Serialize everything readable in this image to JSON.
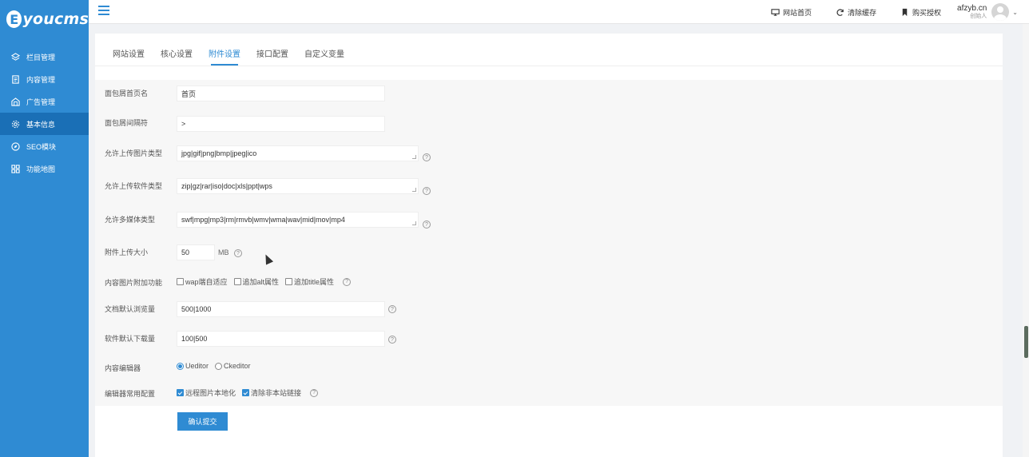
{
  "brand": {
    "badge": "E",
    "name": "youcms"
  },
  "sidebar": {
    "items": [
      {
        "label": "栏目管理",
        "icon": "layers-icon"
      },
      {
        "label": "内容管理",
        "icon": "document-icon"
      },
      {
        "label": "广告管理",
        "icon": "ad-icon"
      },
      {
        "label": "基本信息",
        "icon": "gear-icon"
      },
      {
        "label": "SEO模块",
        "icon": "compass-icon"
      },
      {
        "label": "功能地图",
        "icon": "grid-icon"
      }
    ],
    "active_index": 3
  },
  "topbar": {
    "home_label": "网站首页",
    "clear_cache_label": "清除缓存",
    "buy_license_label": "购买授权",
    "username": "afzyb.cn",
    "role": "创始人"
  },
  "tabs": [
    {
      "label": "网站设置"
    },
    {
      "label": "核心设置"
    },
    {
      "label": "附件设置",
      "active": true
    },
    {
      "label": "接口配置"
    },
    {
      "label": "自定义变量"
    }
  ],
  "form": {
    "breadcrumb_home_label": "面包屑首页名",
    "breadcrumb_home_value": "首页",
    "breadcrumb_sep_label": "面包屑间隔符",
    "breadcrumb_sep_value": ">",
    "image_types_label": "允许上传图片类型",
    "image_types_value": "jpg|gif|png|bmp|jpeg|ico",
    "soft_types_label": "允许上传软件类型",
    "soft_types_value": "zip|gz|rar|iso|doc|xls|ppt|wps",
    "media_types_label": "允许多媒体类型",
    "media_types_value": "swf|mpg|mp3|rm|rmvb|wmv|wma|wav|mid|mov|mp4",
    "upload_size_label": "附件上传大小",
    "upload_size_value": "50",
    "upload_size_unit": "MB",
    "image_extra_label": "内容图片附加功能",
    "image_extra_options": [
      "wap端自适应",
      "追加alt属性",
      "追加title属性"
    ],
    "doc_views_label": "文档默认浏览量",
    "doc_views_value": "500|1000",
    "soft_downloads_label": "软件默认下载量",
    "soft_downloads_value": "100|500",
    "editor_label": "内容编辑器",
    "editor_options": [
      "Ueditor",
      "Ckeditor"
    ],
    "editor_selected": "Ueditor",
    "editor_config_label": "编辑器常用配置",
    "editor_config_options": [
      "远程图片本地化",
      "清除非本站链接"
    ],
    "submit_label": "确认提交",
    "help_glyph": "?"
  }
}
